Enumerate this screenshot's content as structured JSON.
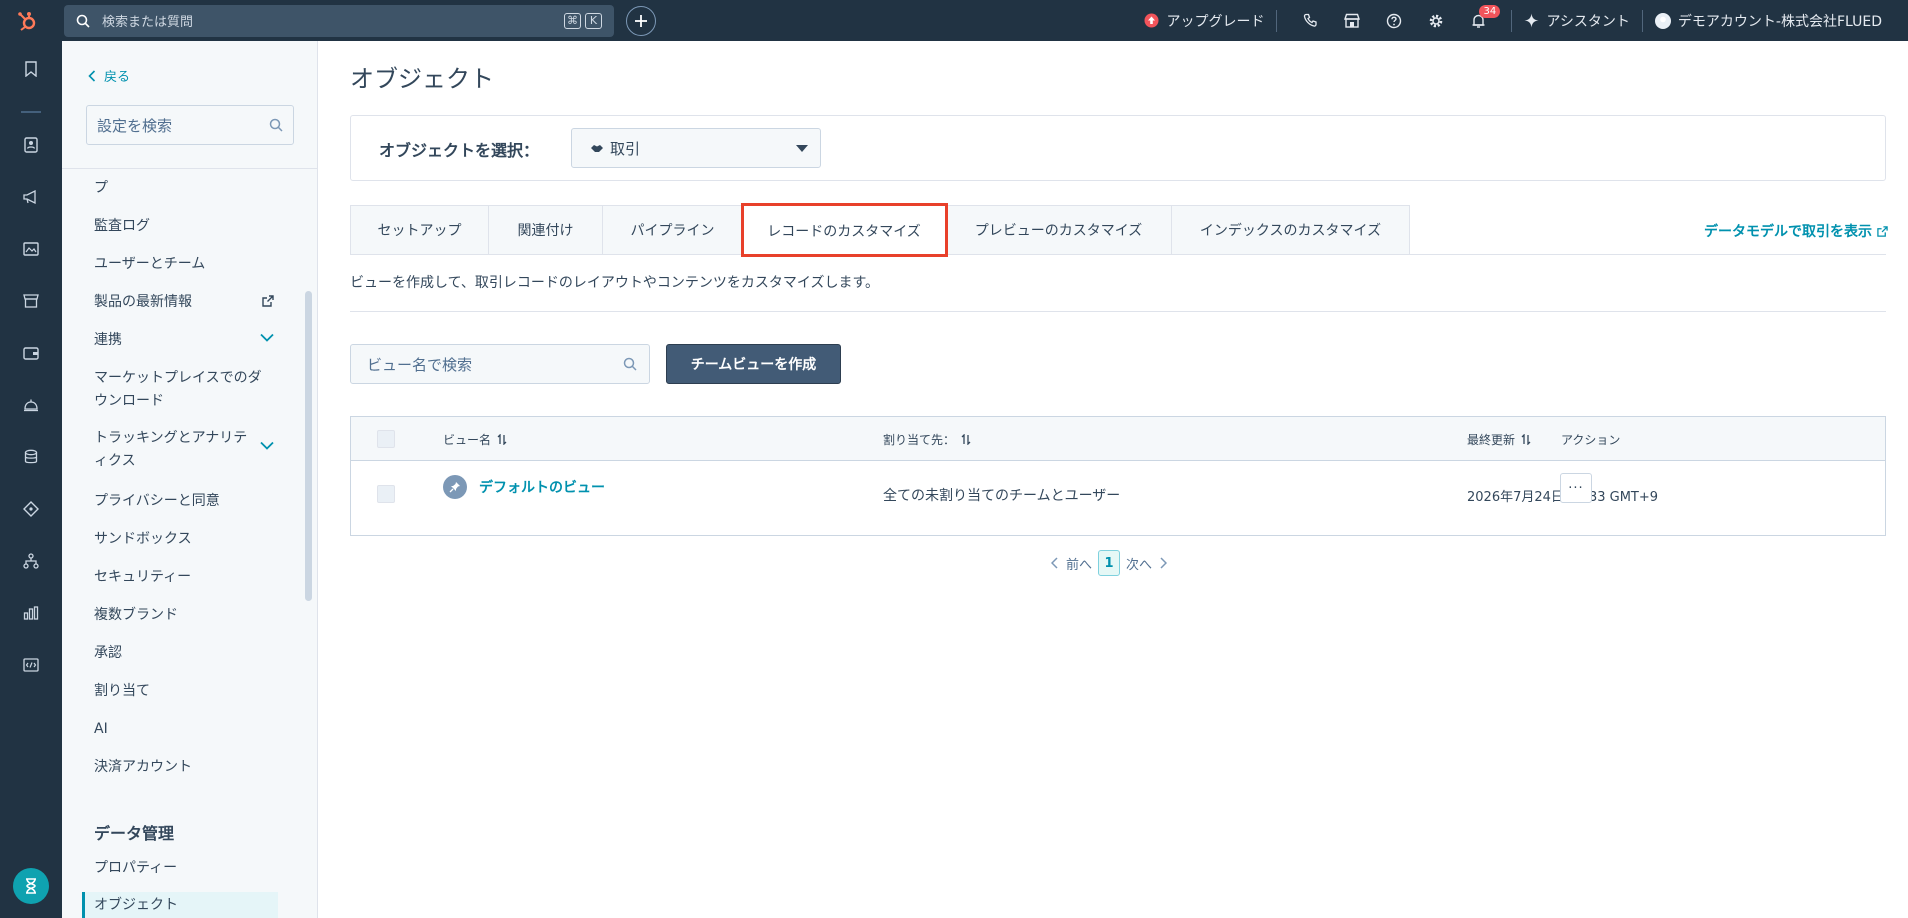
{
  "topbar": {
    "search_placeholder": "検索または質問",
    "shortcut_cmd": "⌘",
    "shortcut_key": "K",
    "upgrade_label": "アップグレード",
    "notification_count": "34",
    "assistant_label": "アシスタント",
    "account_label": "デモアカウント-株式会社FLUED"
  },
  "sidebar": {
    "back_label": "戻る",
    "search_placeholder": "設定を検索",
    "items": [
      {
        "label": "プ"
      },
      {
        "label": "監査ログ"
      },
      {
        "label": "ユーザーとチーム"
      },
      {
        "label": "製品の最新情報"
      },
      {
        "label": "連携"
      },
      {
        "label": "マーケットプレイスでのダウンロード"
      },
      {
        "label": "トラッキングとアナリティクス"
      },
      {
        "label": "プライバシーと同意"
      },
      {
        "label": "サンドボックス"
      },
      {
        "label": "セキュリティー"
      },
      {
        "label": "複数ブランド"
      },
      {
        "label": "承認"
      },
      {
        "label": "割り当て"
      },
      {
        "label": "AI"
      },
      {
        "label": "決済アカウント"
      }
    ],
    "section_heading": "データ管理",
    "section_items": [
      {
        "label": "プロパティー"
      },
      {
        "label": "オブジェクト"
      }
    ]
  },
  "main": {
    "title": "オブジェクト",
    "select_label": "オブジェクトを選択：",
    "select_value": "取引",
    "tabs": [
      {
        "label": "セットアップ"
      },
      {
        "label": "関連付け"
      },
      {
        "label": "パイプライン"
      },
      {
        "label": "レコードのカスタマイズ"
      },
      {
        "label": "プレビューのカスタマイズ"
      },
      {
        "label": "インデックスのカスタマイズ"
      }
    ],
    "model_link": "データモデルで取引を表示",
    "description": "ビューを作成して、取引レコードのレイアウトやコンテンツをカスタマイズします。",
    "view_search_placeholder": "ビュー名で検索",
    "create_button": "チームビューを作成",
    "table": {
      "columns": [
        "ビュー名",
        "割り当て先：",
        "最終更新",
        "アクション"
      ],
      "rows": [
        {
          "name": "デフォルトのビュー",
          "assigned": "全ての未割り当てのチームとユーザー",
          "updated": "2026年7月24日 17:33 GMT+9",
          "action": "···"
        }
      ]
    },
    "pager": {
      "prev": "前へ",
      "current": "1",
      "next": "次へ"
    }
  },
  "colors": {
    "nav_bg": "#213343",
    "accent": "#0091ae",
    "highlight_box": "#e8402a",
    "primary_button": "#425b76"
  }
}
